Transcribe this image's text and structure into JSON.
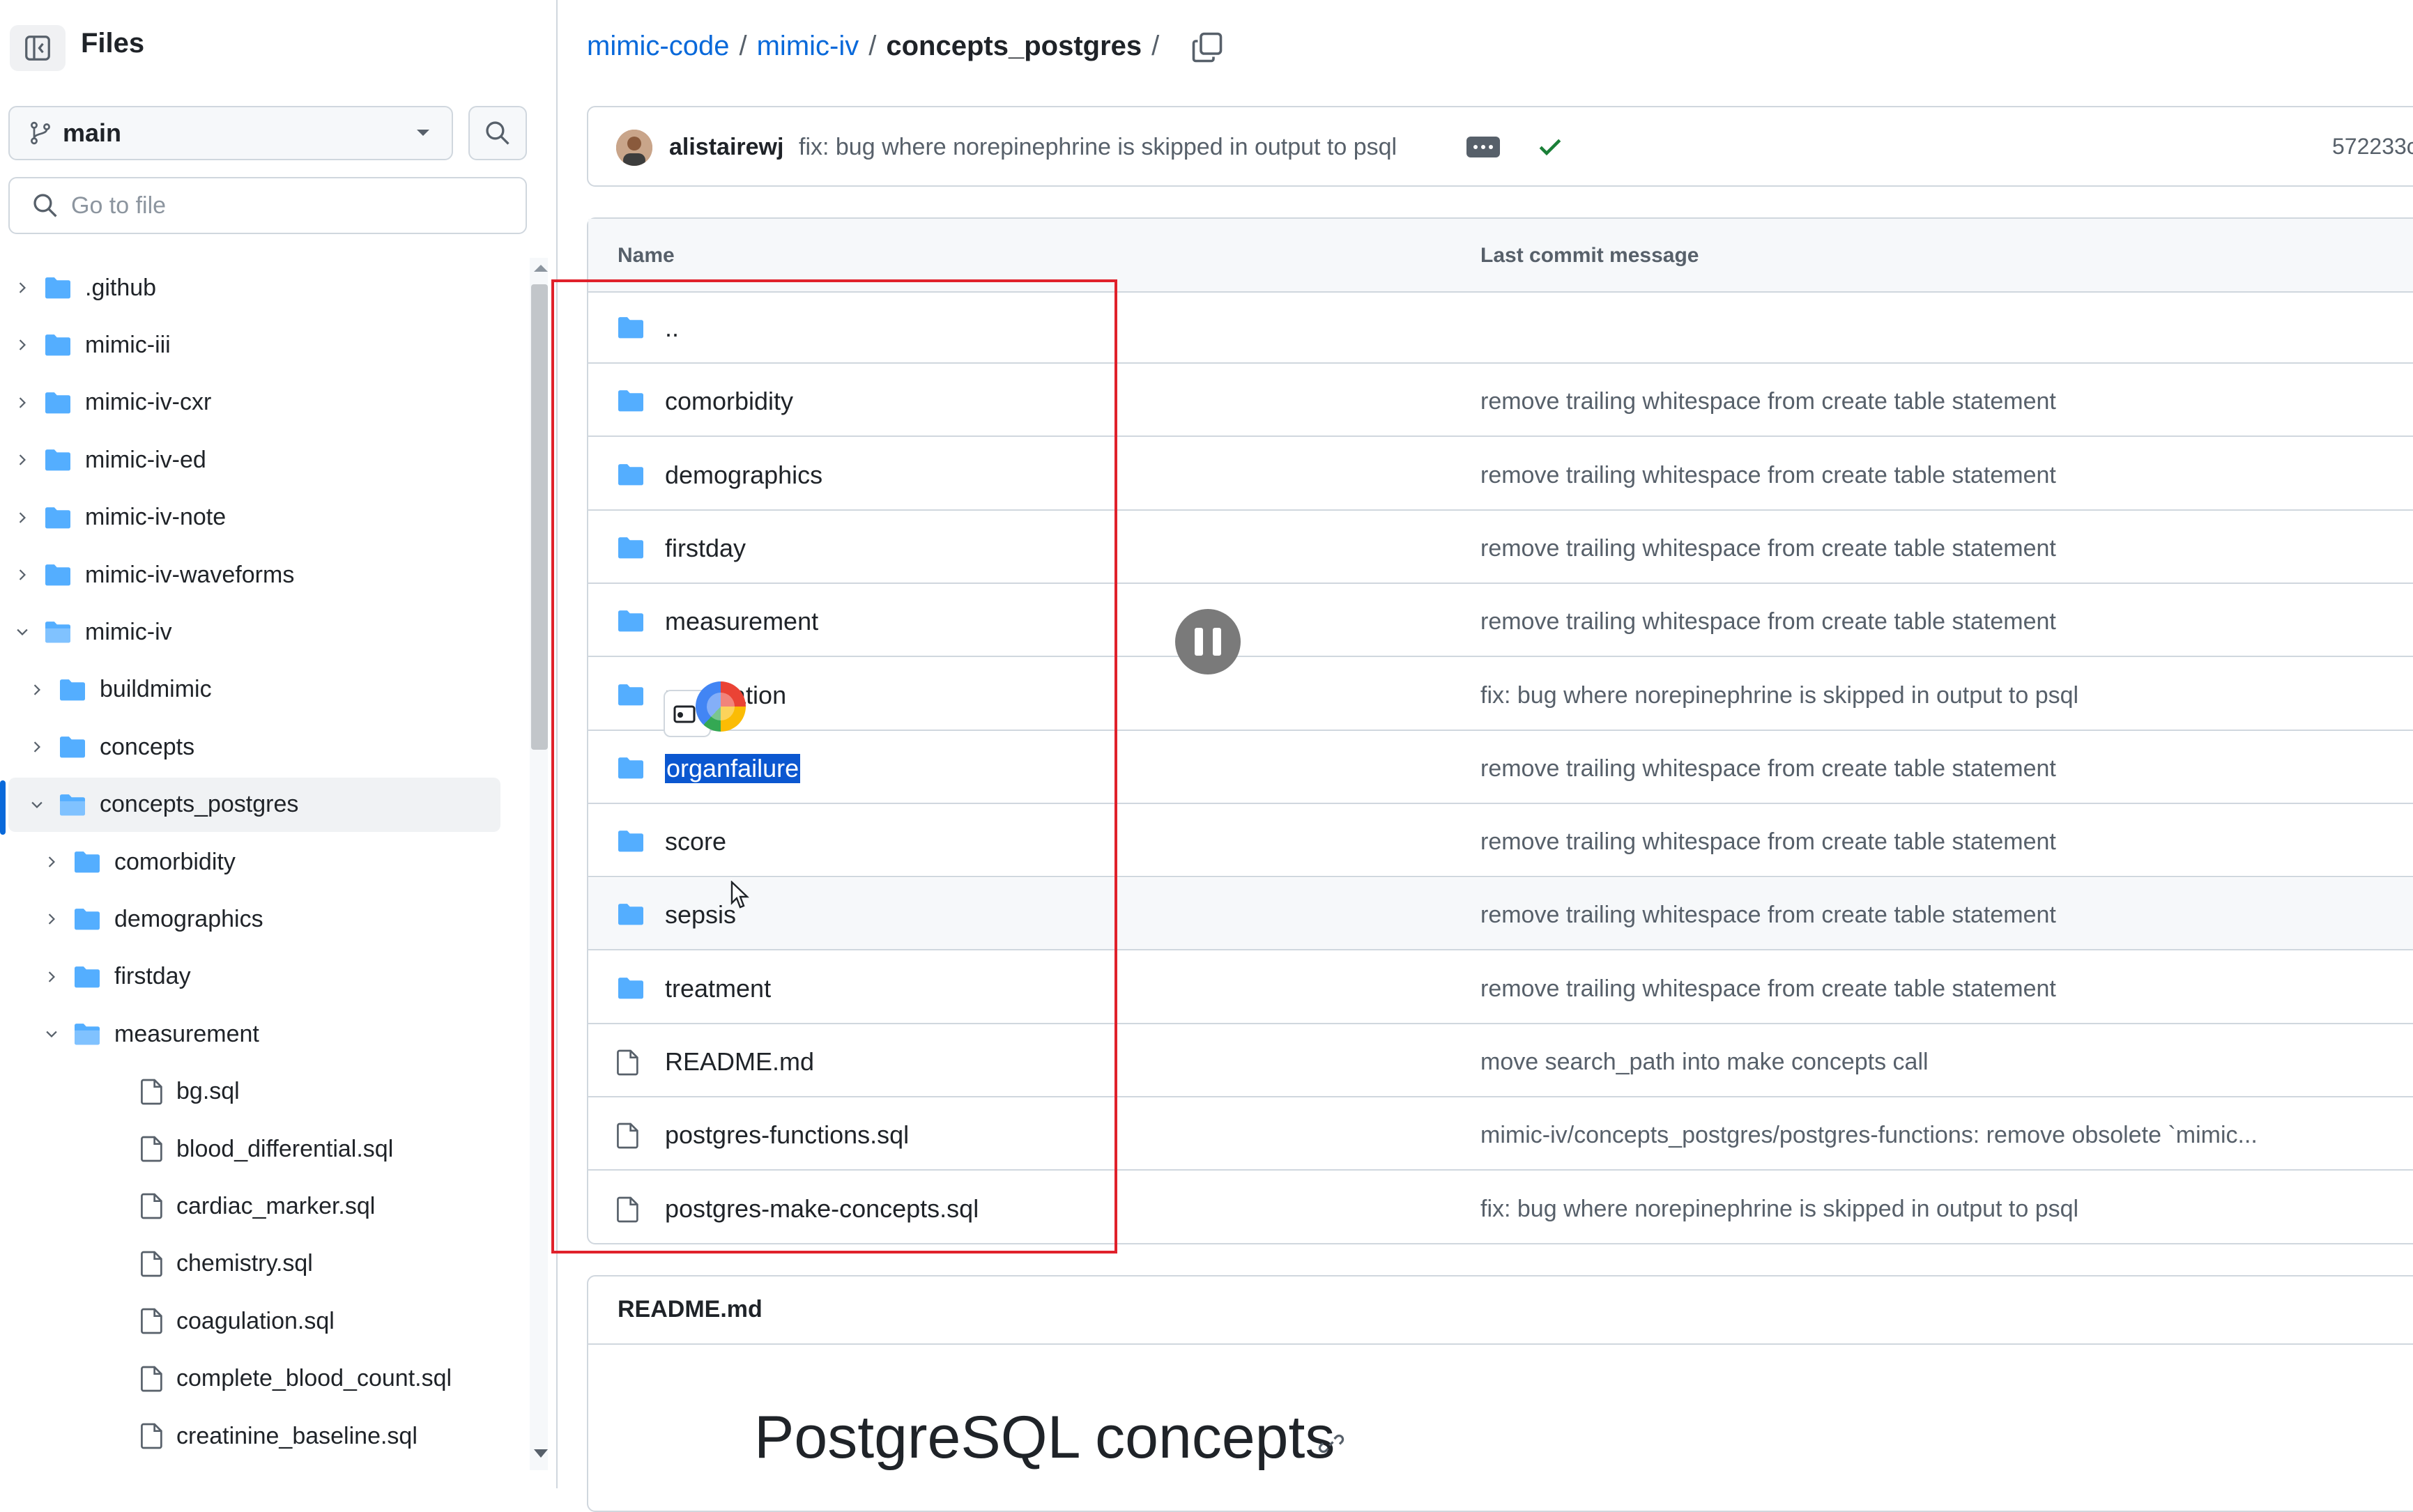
{
  "sidebar": {
    "title": "Files",
    "branch": "main",
    "goto_placeholder": "Go to file",
    "tree": [
      {
        "label": ".github",
        "type": "folder",
        "level": 0,
        "expanded": false
      },
      {
        "label": "mimic-iii",
        "type": "folder",
        "level": 0,
        "expanded": false
      },
      {
        "label": "mimic-iv-cxr",
        "type": "folder",
        "level": 0,
        "expanded": false
      },
      {
        "label": "mimic-iv-ed",
        "type": "folder",
        "level": 0,
        "expanded": false
      },
      {
        "label": "mimic-iv-note",
        "type": "folder",
        "level": 0,
        "expanded": false
      },
      {
        "label": "mimic-iv-waveforms",
        "type": "folder",
        "level": 0,
        "expanded": false
      },
      {
        "label": "mimic-iv",
        "type": "folder",
        "level": 0,
        "expanded": true
      },
      {
        "label": "buildmimic",
        "type": "folder",
        "level": 1,
        "expanded": false
      },
      {
        "label": "concepts",
        "type": "folder",
        "level": 1,
        "expanded": false
      },
      {
        "label": "concepts_postgres",
        "type": "folder",
        "level": 1,
        "expanded": true,
        "selected": true
      },
      {
        "label": "comorbidity",
        "type": "folder",
        "level": 2,
        "expanded": false
      },
      {
        "label": "demographics",
        "type": "folder",
        "level": 2,
        "expanded": false
      },
      {
        "label": "firstday",
        "type": "folder",
        "level": 2,
        "expanded": false
      },
      {
        "label": "measurement",
        "type": "folder",
        "level": 2,
        "expanded": true
      },
      {
        "label": "bg.sql",
        "type": "file",
        "level": 3
      },
      {
        "label": "blood_differential.sql",
        "type": "file",
        "level": 3
      },
      {
        "label": "cardiac_marker.sql",
        "type": "file",
        "level": 3
      },
      {
        "label": "chemistry.sql",
        "type": "file",
        "level": 3
      },
      {
        "label": "coagulation.sql",
        "type": "file",
        "level": 3
      },
      {
        "label": "complete_blood_count.sql",
        "type": "file",
        "level": 3
      },
      {
        "label": "creatinine_baseline.sql",
        "type": "file",
        "level": 3
      }
    ]
  },
  "breadcrumb": {
    "parts": [
      "mimic-code",
      "mimic-iv"
    ],
    "separator": "/",
    "current": "concepts_postgres",
    "trailing": "/"
  },
  "commit": {
    "author": "alistairewj",
    "message": "fix: bug where norepinephrine is skipped in output to psql",
    "sha": "572233c"
  },
  "table": {
    "headers": {
      "name": "Name",
      "message": "Last commit message"
    },
    "rows": [
      {
        "name": "..",
        "type": "folder",
        "message": ""
      },
      {
        "name": "comorbidity",
        "type": "folder",
        "message": "remove trailing whitespace from create table statement"
      },
      {
        "name": "demographics",
        "type": "folder",
        "message": "remove trailing whitespace from create table statement"
      },
      {
        "name": "firstday",
        "type": "folder",
        "message": "remove trailing whitespace from create table statement"
      },
      {
        "name": "measurement",
        "type": "folder",
        "message": "remove trailing whitespace from create table statement"
      },
      {
        "name": "medication",
        "type": "folder",
        "message": "fix: bug where norepinephrine is skipped in output to psql"
      },
      {
        "name": "organfailure",
        "type": "folder",
        "message": "remove trailing whitespace from create table statement",
        "highlighted": true
      },
      {
        "name": "score",
        "type": "folder",
        "message": "remove trailing whitespace from create table statement"
      },
      {
        "name": "sepsis",
        "type": "folder",
        "message": "remove trailing whitespace from create table statement",
        "hover": true
      },
      {
        "name": "treatment",
        "type": "folder",
        "message": "remove trailing whitespace from create table statement"
      },
      {
        "name": "README.md",
        "type": "file",
        "message": "move search_path into make concepts call"
      },
      {
        "name": "postgres-functions.sql",
        "type": "file",
        "message": "mimic-iv/concepts_postgres/postgres-functions: remove obsolete `mimic..."
      },
      {
        "name": "postgres-make-concepts.sql",
        "type": "file",
        "message": "fix: bug where norepinephrine is skipped in output to psql"
      }
    ]
  },
  "readme": {
    "title": "README.md",
    "heading": "PostgreSQL concepts"
  },
  "colors": {
    "link": "#0969da",
    "folder": "#54aeff",
    "annotation_box": "#e0212b",
    "text_highlight": "#0b57d0",
    "check": "#1a7f37"
  }
}
